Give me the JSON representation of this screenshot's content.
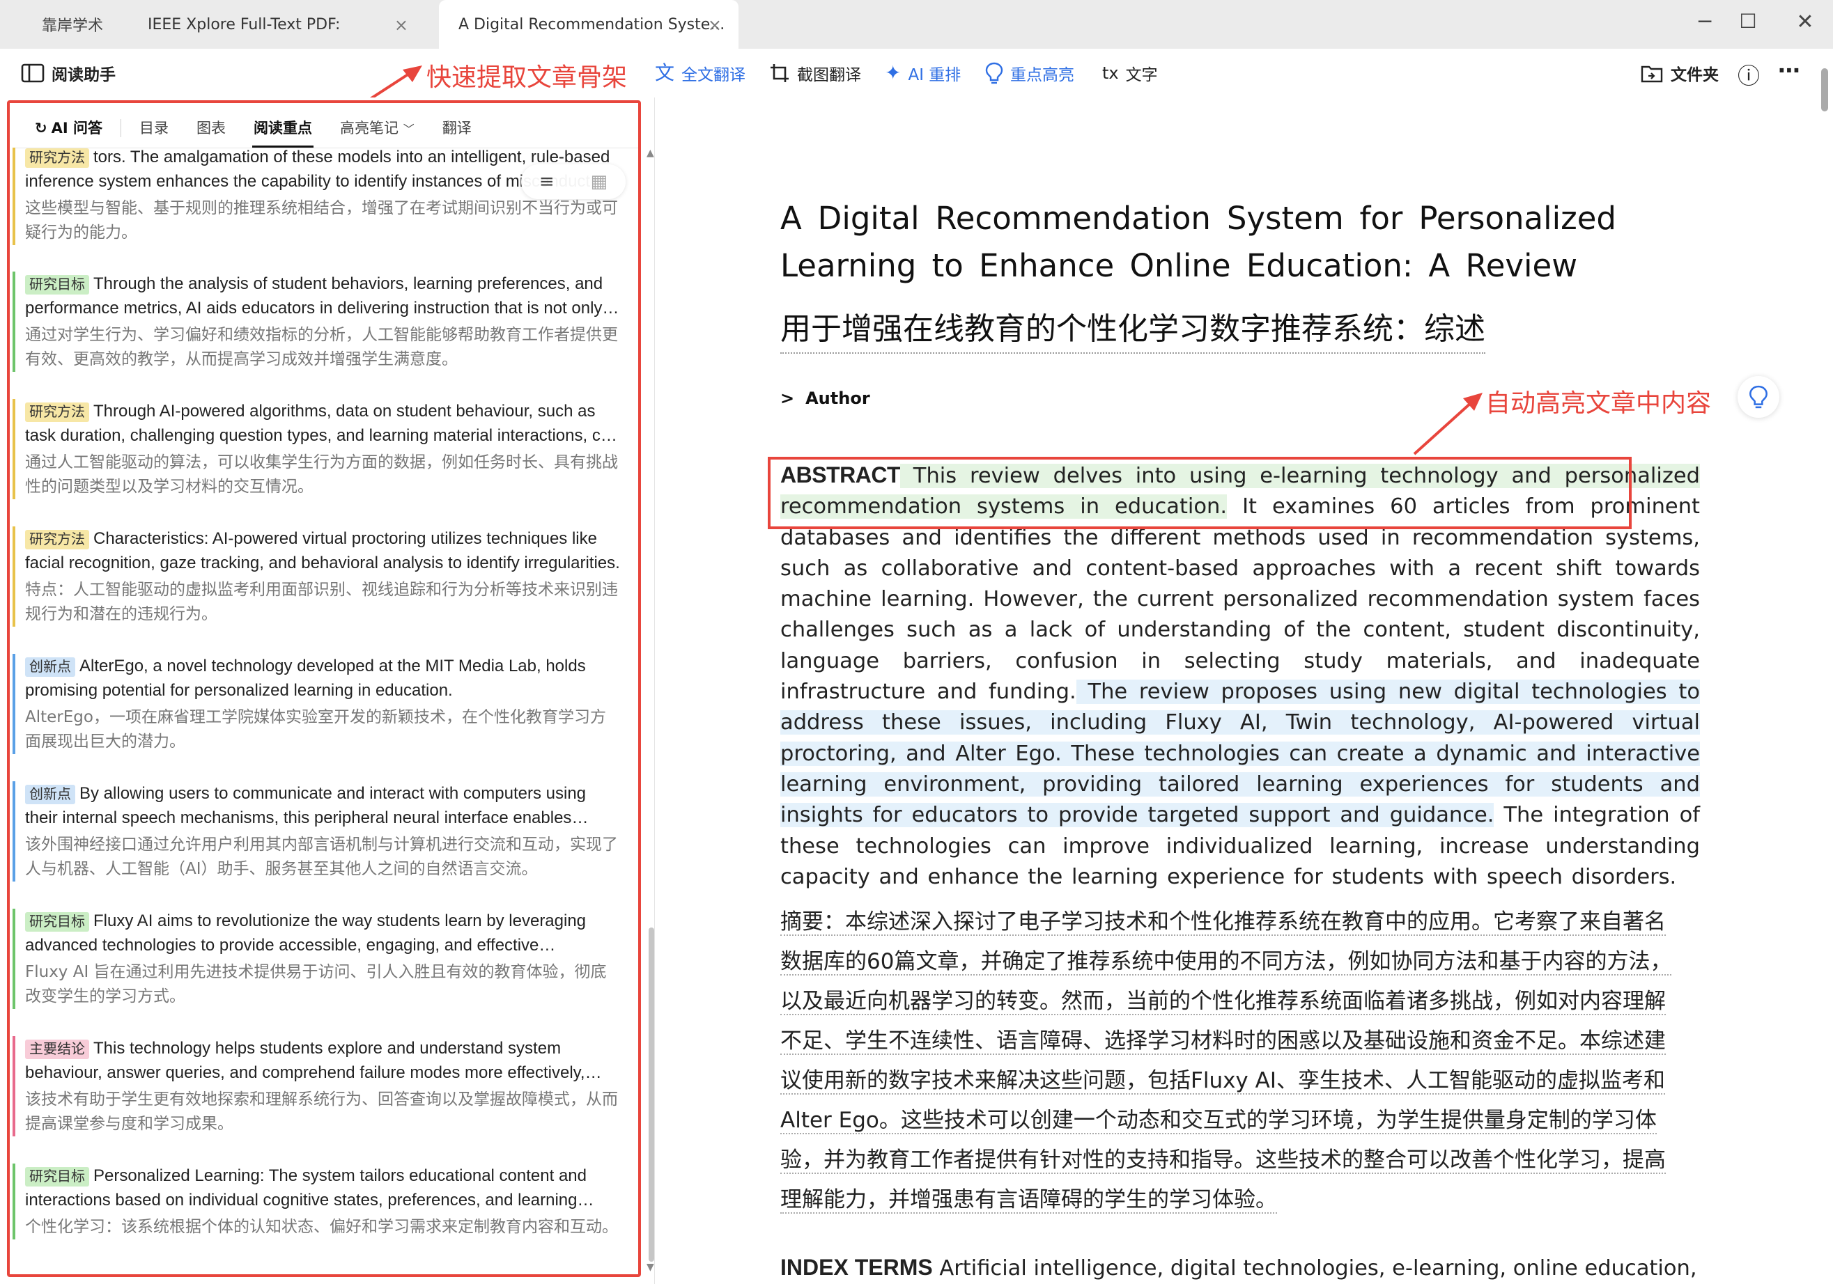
{
  "tabs": [
    {
      "label": "靠岸学术"
    },
    {
      "label": "IEEE Xplore Full-Text PDF:",
      "close": "×"
    },
    {
      "label": "A Digital Recommendation Syste...",
      "close": "×"
    }
  ],
  "window_controls": {
    "minimize": "─",
    "maximize": "☐",
    "close": "✕"
  },
  "toolbar": {
    "assistant": "阅读助手",
    "full_translate": "全文翻译",
    "screenshot_translate": "截图翻译",
    "ai_rearrange": "AI 重排",
    "highlight": "重点高亮",
    "text_icon": "tx",
    "text": "文字",
    "folder": "文件夹",
    "info_icon": "ⓘ",
    "more_icon": "⋯"
  },
  "annotations": {
    "skeleton": "快速提取文章骨架",
    "auto_highlight": "自动高亮文章中内容"
  },
  "subtabs": {
    "ai_qa": "AI 问答",
    "toc": "目录",
    "figures": "图表",
    "key_points": "阅读重点",
    "notes": "高亮笔记",
    "translate": "翻译"
  },
  "notes": [
    {
      "tag": "研究方法",
      "kind": "method",
      "en": "tors. The amalgamation of these models into an intelligent, rule-based inference system enhances the capability to identify instances of misconduct during exams.",
      "cn": "这些模型与智能、基于规则的推理系统相结合，增强了在考试期间识别不当行为或可疑行为的能力。"
    },
    {
      "tag": "研究目标",
      "kind": "goal",
      "en": "Through the analysis of student behaviors, learning preferences, and performance metrics, AI aids educators in delivering instruction that is not only more effective.",
      "cn": "通过对学生行为、学习偏好和绩效指标的分析，人工智能能够帮助教育工作者提供更有效、更高效的教学，从而提高学习成效并增强学生满意度。"
    },
    {
      "tag": "研究方法",
      "kind": "method",
      "en": "Through AI-powered algorithms, data on student behaviour, such as task duration, challenging question types, and learning material interactions, can be collected.",
      "cn": "通过人工智能驱动的算法，可以收集学生行为方面的数据，例如任务时长、具有挑战性的问题类型以及学习材料的交互情况。"
    },
    {
      "tag": "研究方法",
      "kind": "method",
      "en": "Characteristics: AI-powered virtual proctoring utilizes techniques like facial recognition, gaze tracking, and behavioral analysis to identify irregularities.",
      "cn": "特点：人工智能驱动的虚拟监考利用面部识别、视线追踪和行为分析等技术来识别违规行为和潜在的违规行为。"
    },
    {
      "tag": "创新点",
      "kind": "innov",
      "en": "AlterEgo, a novel technology developed at the MIT Media Lab, holds promising potential for personalized learning in education.",
      "cn": "AlterEgo，一项在麻省理工学院媒体实验室开发的新颖技术，在个性化教育学习方面展现出巨大的潜力。"
    },
    {
      "tag": "创新点",
      "kind": "innov",
      "en": "By allowing users to communicate and interact with computers using their internal speech mechanisms, this peripheral neural interface enables seamless interaction.",
      "cn": "该外围神经接口通过允许用户利用其内部言语机制与计算机进行交流和互动，实现了人与机器、人工智能（AI）助手、服务甚至其他人之间的自然语言交流。"
    },
    {
      "tag": "研究目标",
      "kind": "goal",
      "en": "Fluxy AI aims to revolutionize the way students learn by leveraging advanced technologies to provide accessible, engaging, and effective educational experiences.",
      "cn": "Fluxy AI 旨在通过利用先进技术提供易于访问、引人入胜且有效的教育体验，彻底改变学生的学习方式。"
    },
    {
      "tag": "主要结论",
      "kind": "concl",
      "en": "This technology helps students explore and understand system behaviour, answer queries, and comprehend failure modes more effectively, improving outcomes.",
      "cn": "该技术有助于学生更有效地探索和理解系统行为、回答查询以及掌握故障模式，从而提高课堂参与度和学习成果。"
    },
    {
      "tag": "研究目标",
      "kind": "goal",
      "en": "Personalized Learning: The system tailors educational content and interactions based on individual cognitive states, preferences, and learning needs.",
      "cn": "个性化学习：该系统根据个体的认知状态、偏好和学习需求来定制教育内容和互动。"
    }
  ],
  "document": {
    "title": "A Digital Recommendation System for Personalized Learning to Enhance Online Education: A Review",
    "title_cn": "用于增强在线教育的个性化学习数字推荐系统：综述",
    "author_chevron": ">",
    "author_label": "Author",
    "abstract_kw": "ABSTRACT",
    "abstract_p1": " This review delves into using e-learning technology and personalized recommendation systems in education.",
    "abstract_p2": " It examines 60 articles from prominent databases and identifies the different methods used in recommendation systems, such as collaborative and content-based approaches with a recent shift towards machine learning. However, the current personalized recommendation system faces challenges such as a lack of understanding of the content, student discontinuity, language barriers, confusion in selecting study materials, and inadequate infrastructure and funding.",
    "abstract_p3": " The review proposes using new digital technologies to address these issues, including Fluxy AI, Twin technology, AI-powered virtual proctoring, and Alter Ego. These technologies can create a dynamic and interactive learning environment, providing tailored learning experiences for students and insights for educators to provide targeted support and guidance.",
    "abstract_p4": " The integration of these technologies can improve individualized learning, increase understanding capacity and enhance the learning experience for students with speech disorders.",
    "abstract_cn": "摘要：本综述深入探讨了电子学习技术和个性化推荐系统在教育中的应用。它考察了来自著名数据库的60篇文章，并确定了推荐系统中使用的不同方法，例如协同方法和基于内容的方法，以及最近向机器学习的转变。然而，当前的个性化推荐系统面临着诸多挑战，例如对内容理解不足、学生不连续性、语言障碍、选择学习材料时的困惑以及基础设施和资金不足。本综述建议使用新的数字技术来解决这些问题，包括Fluxy AI、孪生技术、人工智能驱动的虚拟监考和Alter Ego。这些技术可以创建一个动态和交互式的学习环境，为学生提供量身定制的学习体验，并为教育工作者提供有针对性的支持和指导。这些技术的整合可以改善个性化学习，提高理解能力，并增强患有言语障碍的学生的学习体验。",
    "index_kw": "INDEX TERMS",
    "index_terms": " Artificial intelligence, digital technologies, e-learning, online education,"
  },
  "colors": {
    "accent": "#2f6fe4",
    "annotation": "#e8453c",
    "highlight_green": "#e5f4e3",
    "highlight_blue": "#e4f1fb"
  }
}
